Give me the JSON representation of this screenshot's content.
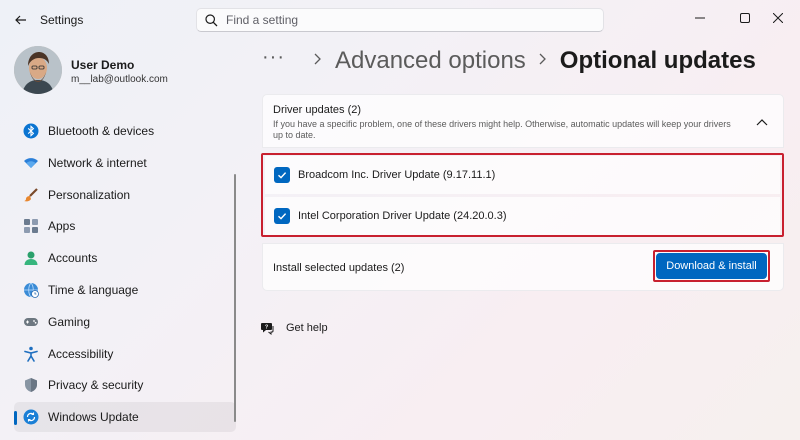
{
  "app": {
    "title": "Settings"
  },
  "search": {
    "placeholder": "Find a setting"
  },
  "user": {
    "name": "User Demo",
    "email": "m__lab@outlook.com"
  },
  "sidebar": {
    "items": [
      {
        "label": "Bluetooth & devices",
        "icon": "bluetooth-icon"
      },
      {
        "label": "Network & internet",
        "icon": "wifi-icon"
      },
      {
        "label": "Personalization",
        "icon": "brush-icon"
      },
      {
        "label": "Apps",
        "icon": "apps-icon"
      },
      {
        "label": "Accounts",
        "icon": "person-icon"
      },
      {
        "label": "Time & language",
        "icon": "globe-clock-icon"
      },
      {
        "label": "Gaming",
        "icon": "gamepad-icon"
      },
      {
        "label": "Accessibility",
        "icon": "accessibility-icon"
      },
      {
        "label": "Privacy & security",
        "icon": "shield-icon"
      },
      {
        "label": "Windows Update",
        "icon": "update-icon",
        "active": true
      }
    ]
  },
  "breadcrumb": {
    "more": "···",
    "previous": "Advanced options",
    "current": "Optional updates"
  },
  "driver_updates": {
    "title": "Driver updates (2)",
    "description": "If you have a specific problem, one of these drivers might help. Otherwise, automatic updates will keep your drivers up to date.",
    "items": [
      {
        "label": "Broadcom Inc. Driver Update (9.17.11.1)",
        "checked": true
      },
      {
        "label": "Intel Corporation Driver Update (24.20.0.3)",
        "checked": true
      }
    ],
    "footer_label": "Install selected updates (2)",
    "install_button": "Download & install"
  },
  "help": {
    "label": "Get help"
  },
  "colors": {
    "accent": "#0067c0",
    "highlight": "#c8202f"
  }
}
